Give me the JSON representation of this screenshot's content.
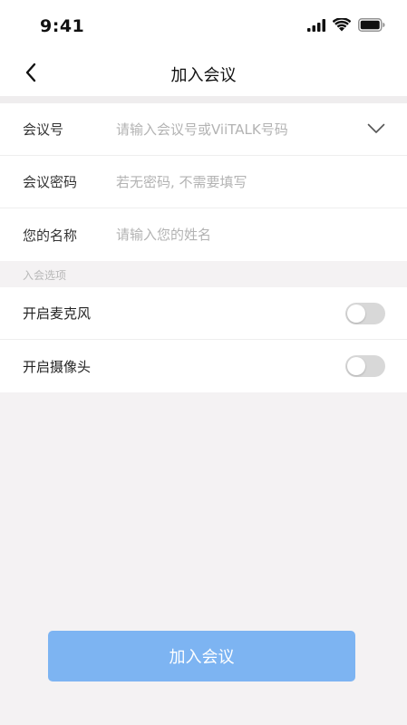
{
  "status_bar": {
    "time": "9:41",
    "icons": [
      "signal-icon",
      "wifi-icon",
      "battery-icon"
    ]
  },
  "nav": {
    "title": "加入会议",
    "back_icon": "chevron-left-icon"
  },
  "form": {
    "meeting_id": {
      "label": "会议号",
      "placeholder": "请输入会议号或ViiTALK号码",
      "value": "",
      "dropdown_icon": "chevron-down-icon"
    },
    "password": {
      "label": "会议密码",
      "placeholder": "若无密码, 不需要填写",
      "value": ""
    },
    "name": {
      "label": "您的名称",
      "placeholder": "请输入您的姓名",
      "value": ""
    }
  },
  "options": {
    "header": "入会选项",
    "items": [
      {
        "label": "开启麦克风",
        "on": false
      },
      {
        "label": "开启摄像头",
        "on": false
      }
    ]
  },
  "join_button": {
    "label": "加入会议"
  },
  "colors": {
    "accent_disabled": "#7db4f2",
    "toggle_off": "#d8d8d8",
    "background": "#f4f2f3"
  }
}
